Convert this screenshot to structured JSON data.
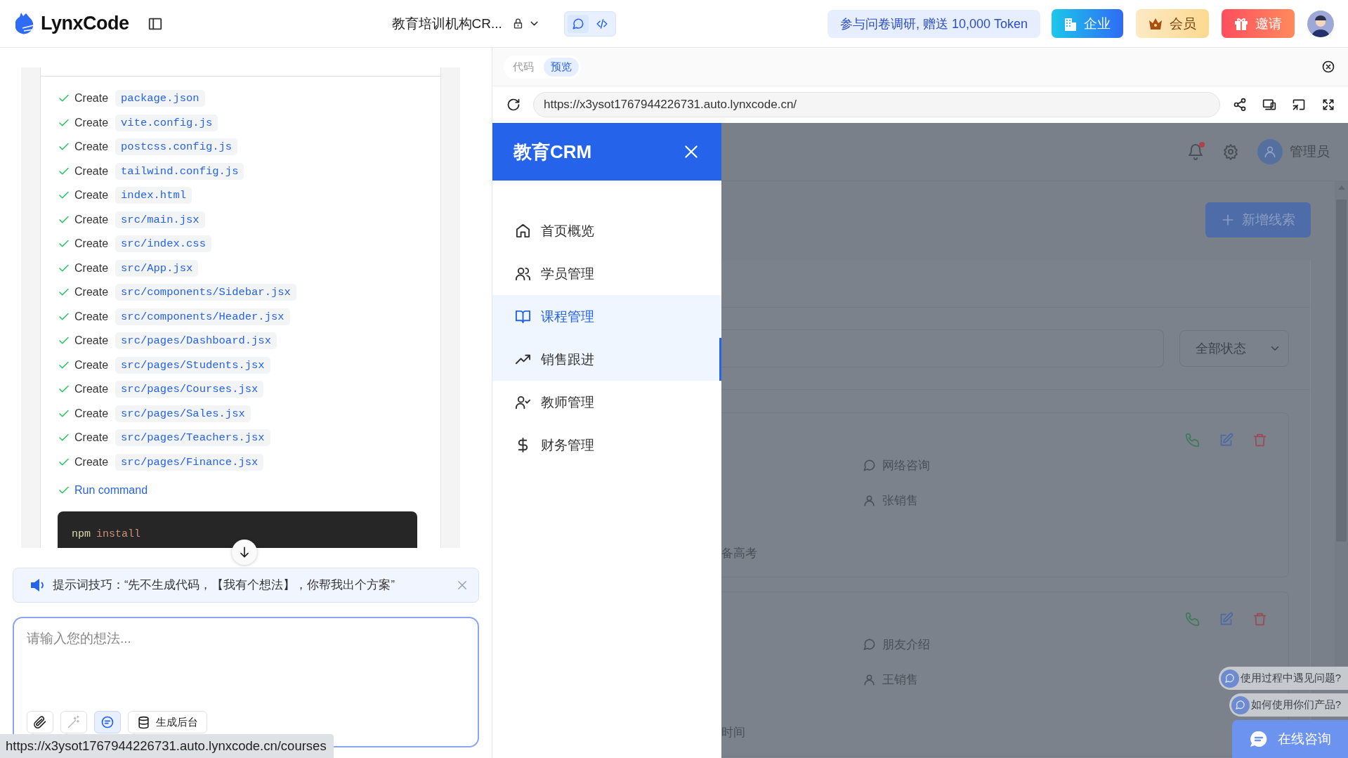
{
  "topbar": {
    "logo": "LynxCode",
    "project_title": "教育培训机构CR...",
    "view_toggle": [
      {
        "kind": "chat",
        "selected": true
      },
      {
        "kind": "code",
        "selected": false
      }
    ],
    "survey": "参与问卷调研, 赠送 10,000 Token",
    "buttons": [
      {
        "kind": "enterprise",
        "label": "企业"
      },
      {
        "kind": "member",
        "label": "会员"
      },
      {
        "kind": "invite",
        "label": "邀请"
      }
    ]
  },
  "chat": {
    "steps": [
      {
        "action": "Create",
        "file": "package.json",
        "done": true
      },
      {
        "action": "Create",
        "file": "vite.config.js",
        "done": true
      },
      {
        "action": "Create",
        "file": "postcss.config.js",
        "done": true
      },
      {
        "action": "Create",
        "file": "tailwind.config.js",
        "done": true
      },
      {
        "action": "Create",
        "file": "index.html",
        "done": true
      },
      {
        "action": "Create",
        "file": "src/main.jsx",
        "done": true
      },
      {
        "action": "Create",
        "file": "src/index.css",
        "done": true
      },
      {
        "action": "Create",
        "file": "src/App.jsx",
        "done": true
      },
      {
        "action": "Create",
        "file": "src/components/Sidebar.jsx",
        "done": true
      },
      {
        "action": "Create",
        "file": "src/components/Header.jsx",
        "done": true
      },
      {
        "action": "Create",
        "file": "src/pages/Dashboard.jsx",
        "done": true
      },
      {
        "action": "Create",
        "file": "src/pages/Students.jsx",
        "done": true
      },
      {
        "action": "Create",
        "file": "src/pages/Courses.jsx",
        "done": true
      },
      {
        "action": "Create",
        "file": "src/pages/Sales.jsx",
        "done": true
      },
      {
        "action": "Create",
        "file": "src/pages/Teachers.jsx",
        "done": true
      },
      {
        "action": "Create",
        "file": "src/pages/Finance.jsx",
        "done": true
      }
    ],
    "run": {
      "label": "Run command",
      "done": true
    },
    "command": {
      "program": "npm",
      "args": "install"
    },
    "tip": "提示词技巧：“先不生成代码，【我有个想法】，你帮我出个方案”",
    "input": {
      "placeholder": "请输入您的想法..."
    },
    "tools": [
      {
        "kind": "attach",
        "selected": false,
        "disabled": false
      },
      {
        "kind": "magic",
        "selected": false,
        "disabled": true
      },
      {
        "kind": "chat",
        "selected": true,
        "disabled": false
      }
    ],
    "backend_button": "生成后台"
  },
  "status_url": "https://x3ysot1767944226731.auto.lynxcode.cn/courses",
  "preview": {
    "tabs": [
      {
        "label": "代码",
        "selected": false
      },
      {
        "label": "预览",
        "selected": true
      }
    ],
    "url": "https://x3ysot1767944226731.auto.lynxcode.cn/",
    "app": {
      "brand": "教育CRM",
      "nav": [
        {
          "kind": "home",
          "label": "首页概览",
          "hovered": false,
          "selected": false
        },
        {
          "kind": "students",
          "label": "学员管理",
          "hovered": false,
          "selected": false
        },
        {
          "kind": "courses",
          "label": "课程管理",
          "hovered": true,
          "selected": false
        },
        {
          "kind": "sales",
          "label": "销售跟进",
          "hovered": false,
          "selected": true
        },
        {
          "kind": "teachers",
          "label": "教师管理",
          "hovered": false,
          "selected": false
        },
        {
          "kind": "finance",
          "label": "财务管理",
          "hovered": false,
          "selected": false
        }
      ],
      "notification": true,
      "user": "管理员",
      "add_button": "新增线索",
      "status_filter": "全部状态",
      "leads": [
        {
          "source": "网络咨询",
          "owner": "张销售",
          "note": "备高考"
        },
        {
          "source": "朋友介绍",
          "owner": "王销售",
          "note": "时间"
        }
      ]
    },
    "help": {
      "questions": [
        "使用过程中遇见问题?",
        "如何使用你们产品?"
      ],
      "chat_button": "在线咨询"
    }
  }
}
